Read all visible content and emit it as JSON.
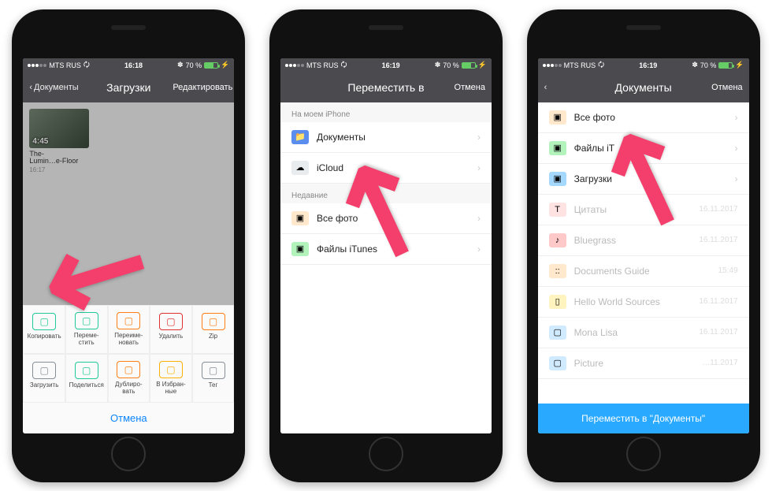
{
  "status": {
    "carrier": "MTS RUS",
    "time1": "16:18",
    "time2": "16:19",
    "time3": "16:19",
    "battery": "70 %",
    "bt": "✽"
  },
  "phone1": {
    "back": "Документы",
    "title": "Загрузки",
    "action": "Редактировать",
    "video": {
      "duration": "4:45",
      "name": "The-\nLumin…e-Floor",
      "time": "16:17"
    },
    "sheet": {
      "cells": [
        {
          "label": "Копировать",
          "color": "#20c997"
        },
        {
          "label": "Переме-\nстить",
          "color": "#20c997"
        },
        {
          "label": "Переиме-\nновать",
          "color": "#fd7e14"
        },
        {
          "label": "Удалить",
          "color": "#e03131"
        },
        {
          "label": "Zip",
          "color": "#fd7e14"
        },
        {
          "label": "Загрузить",
          "color": "#868e96"
        },
        {
          "label": "Поделиться",
          "color": "#20c997"
        },
        {
          "label": "Дублиро-\nвать",
          "color": "#fd7e14"
        },
        {
          "label": "В Избран-\nные",
          "color": "#fab005"
        },
        {
          "label": "Тег",
          "color": "#868e96"
        }
      ],
      "cancel": "Отмена"
    }
  },
  "phone2": {
    "title": "Переместить в",
    "action": "Отмена",
    "section1": "На моем iPhone",
    "section2": "Недавние",
    "rows1": [
      {
        "icon": "📁",
        "bg": "#5b8def",
        "label": "Документы"
      },
      {
        "icon": "☁",
        "bg": "#e9ecef",
        "label": "iCloud"
      }
    ],
    "rows2": [
      {
        "icon": "▣",
        "bg": "#ffe8cc",
        "label": "Все фото"
      },
      {
        "icon": "▣",
        "bg": "#b2f2bb",
        "label": "Файлы iTunes"
      }
    ]
  },
  "phone3": {
    "title": "Документы",
    "action": "Отмена",
    "rows": [
      {
        "icon": "▣",
        "bg": "#ffe8cc",
        "label": "Все фото",
        "meta": "",
        "chev": true
      },
      {
        "icon": "▣",
        "bg": "#b2f2bb",
        "label": "Файлы iT",
        "meta": "",
        "chev": true
      },
      {
        "icon": "▣",
        "bg": "#a5d8ff",
        "label": "Загрузки",
        "meta": "",
        "chev": true
      },
      {
        "icon": "T",
        "bg": "#ffe3e3",
        "label": "Цитаты",
        "meta": "16.11.2017",
        "faded": true
      },
      {
        "icon": "♪",
        "bg": "#ffc9c9",
        "label": "Bluegrass",
        "meta": "16.11.2017",
        "faded": true
      },
      {
        "icon": "::",
        "bg": "#ffe8cc",
        "label": "Documents Guide",
        "meta": "15:49",
        "faded": true
      },
      {
        "icon": "▯",
        "bg": "#fff3bf",
        "label": "Hello World Sources",
        "meta": "16.11.2017",
        "faded": true
      },
      {
        "icon": "▢",
        "bg": "#d0ebff",
        "label": "Mona Lisa",
        "meta": "16.11.2017",
        "faded": true
      },
      {
        "icon": "▢",
        "bg": "#d0ebff",
        "label": "Picture",
        "meta": "…11.2017",
        "faded": true
      }
    ],
    "button": "Переместить в \"Документы\""
  }
}
